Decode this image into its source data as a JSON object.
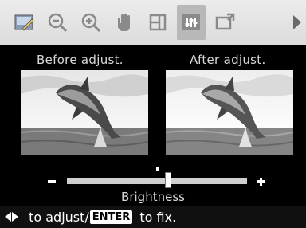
{
  "toolbar": {
    "items": [
      {
        "icon": "edit-photo-icon"
      },
      {
        "icon": "zoom-out-icon"
      },
      {
        "icon": "zoom-in-icon"
      },
      {
        "icon": "hand-move-icon"
      },
      {
        "icon": "rotate-frame-icon"
      },
      {
        "icon": "adjust-sliders-icon",
        "active": true
      },
      {
        "icon": "export-frame-icon"
      }
    ]
  },
  "preview": {
    "before_label": "Before adjust.",
    "after_label": "After adjust."
  },
  "slider": {
    "minus_symbol": "−",
    "plus_symbol": "+",
    "name": "Brightness",
    "value_fraction": 0.56
  },
  "footer": {
    "adjust_text": " to adjust/",
    "enter_key": "ENTER",
    "fix_text": " to fix."
  },
  "colors": {
    "toolbar_bg": "#e4e4e4",
    "active_tool_bg": "#b8b8b8",
    "screen_bg": "#000000",
    "footer_bg": "#101010"
  }
}
